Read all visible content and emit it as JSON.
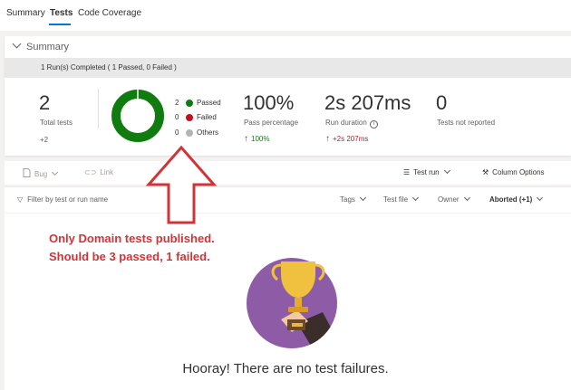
{
  "tabs": [
    {
      "label": "Summary"
    },
    {
      "label": "Tests"
    },
    {
      "label": "Code Coverage"
    }
  ],
  "summary": {
    "heading": "Summary",
    "run_status": "1 Run(s) Completed ( 1 Passed, 0 Failed )",
    "total_tests": {
      "value": "2",
      "label": "Total tests",
      "delta": "+2"
    },
    "outcome_legend": [
      {
        "count": "2",
        "label": "Passed",
        "color": "#107c10"
      },
      {
        "count": "0",
        "label": "Failed",
        "color": "#c50f1f"
      },
      {
        "count": "0",
        "label": "Others",
        "color": "#b4b4b4"
      }
    ],
    "pass_percentage": {
      "value": "100%",
      "label": "Pass percentage",
      "delta": "100%"
    },
    "run_duration": {
      "value": "2s 207ms",
      "label": "Run duration",
      "delta": "+2s 207ms"
    },
    "not_reported": {
      "value": "0",
      "label": "Tests not reported"
    }
  },
  "toolbar": {
    "bug": "Bug",
    "link": "Link",
    "test_run": "Test run",
    "column_options": "Column Options"
  },
  "filters": {
    "search_placeholder": "Filter by test or run name",
    "tags": "Tags",
    "test_file": "Test file",
    "owner": "Owner",
    "outcome": "Aborted (+1)"
  },
  "annotation": {
    "line1": "Only Domain tests published.",
    "line2": "Should be 3 passed, 1 failed."
  },
  "empty_state": {
    "message": "Hooray! There are no test failures."
  },
  "colors": {
    "accent": "#0078d4",
    "passed": "#107c10",
    "failed": "#c50f1f",
    "annotation": "#d13438"
  }
}
